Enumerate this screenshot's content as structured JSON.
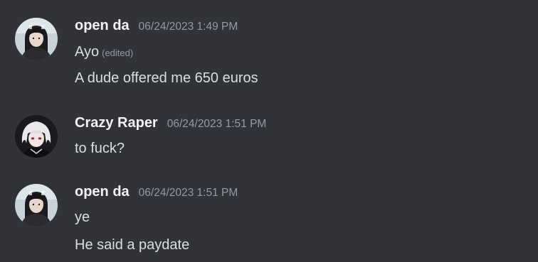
{
  "messages": [
    {
      "author": "open da",
      "timestamp": "06/24/2023 1:49 PM",
      "avatar_icon": "avatar-dark-hair-girl-icon",
      "lines": [
        {
          "text": "Ayo",
          "edited": "(edited)"
        },
        {
          "text": "A dude offered me 650 euros"
        }
      ]
    },
    {
      "author": "Crazy Raper",
      "timestamp": "06/24/2023 1:51 PM",
      "avatar_icon": "avatar-white-hair-anime-icon",
      "lines": [
        {
          "text": "to fuck?"
        }
      ]
    },
    {
      "author": "open da",
      "timestamp": "06/24/2023 1:51 PM",
      "avatar_icon": "avatar-dark-hair-girl-icon",
      "lines": [
        {
          "text": "ye"
        },
        {
          "text": "He said a paydate"
        }
      ]
    }
  ],
  "colors": {
    "background": "#313338",
    "username": "#f2f3f5",
    "timestamp": "#949ba4",
    "message_text": "#dbdee1"
  }
}
